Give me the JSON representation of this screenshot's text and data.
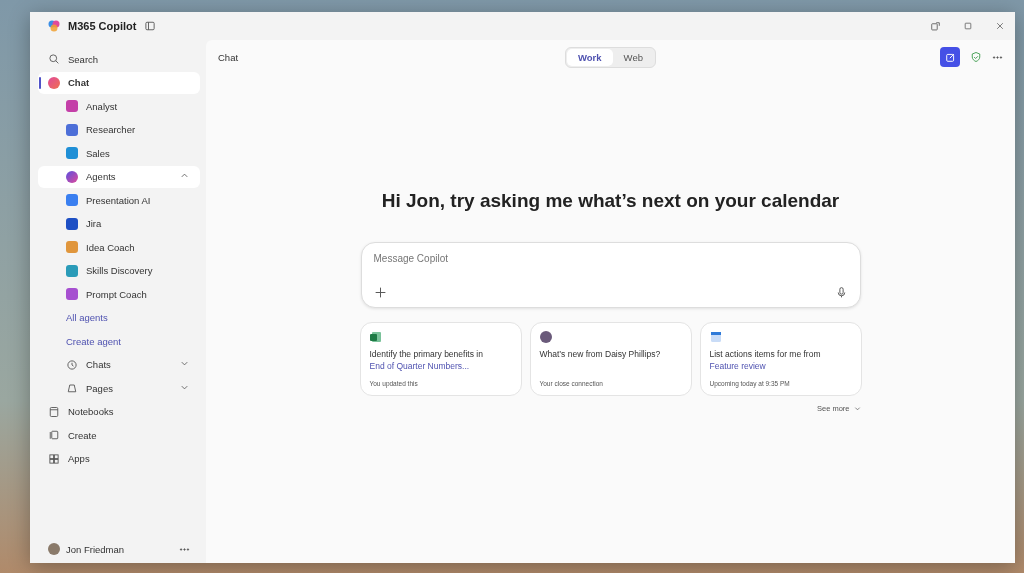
{
  "window": {
    "title": "M365 Copilot"
  },
  "sidebar": {
    "search": "Search",
    "items": [
      {
        "label": "Chat",
        "kind": "chat",
        "selected": true,
        "hovered": false,
        "children": [
          {
            "label": "Analyst",
            "kind": "agent",
            "color": "#c43fa8",
            "selected": false,
            "hovered": false
          },
          {
            "label": "Researcher",
            "kind": "agent",
            "color": "#4d6fd8",
            "selected": false,
            "hovered": false
          },
          {
            "label": "Sales",
            "kind": "agent",
            "color": "#1f8fd6",
            "selected": false,
            "hovered": false
          },
          {
            "label": "Agents",
            "kind": "agents",
            "selected": false,
            "hovered": true,
            "expanded": true,
            "children": [
              {
                "label": "Presentation AI",
                "kind": "agent",
                "color": "#3a7ff0",
                "selected": false,
                "hovered": false
              },
              {
                "label": "Jira",
                "kind": "agent",
                "color": "#1d4fc4",
                "selected": false,
                "hovered": false
              },
              {
                "label": "Idea Coach",
                "kind": "agent",
                "color": "#e0963c",
                "selected": false,
                "hovered": false
              },
              {
                "label": "Skills Discovery",
                "kind": "agent",
                "color": "#2a9bb8",
                "selected": false,
                "hovered": false
              },
              {
                "label": "Prompt Coach",
                "kind": "agent",
                "color": "#a64fd0",
                "selected": false,
                "hovered": false
              },
              {
                "label": "All agents",
                "kind": "link",
                "selected": false,
                "hovered": false
              },
              {
                "label": "Create agent",
                "kind": "link",
                "selected": false,
                "hovered": false
              }
            ]
          },
          {
            "label": "Chats",
            "kind": "history",
            "selected": false,
            "hovered": false,
            "expanded": false
          },
          {
            "label": "Pages",
            "kind": "pages",
            "selected": false,
            "hovered": false,
            "expanded": false
          }
        ]
      },
      {
        "label": "Notebooks",
        "kind": "notebooks",
        "selected": false,
        "hovered": false
      },
      {
        "label": "Create",
        "kind": "create",
        "selected": false,
        "hovered": false
      },
      {
        "label": "Apps",
        "kind": "apps",
        "selected": false,
        "hovered": false
      }
    ],
    "user": "Jon Friedman"
  },
  "header": {
    "title": "Chat",
    "tabs": [
      {
        "label": "Work",
        "selected": true
      },
      {
        "label": "Web",
        "selected": false
      }
    ]
  },
  "greeting": "Hi Jon, try asking me what’s next on your calendar",
  "composer": {
    "placeholder": "Message Copilot"
  },
  "cards": [
    {
      "kind": "spreadsheet",
      "text": "Identify the primary benefits in",
      "link": "End of Quarter Numbers...",
      "note": "You updated this"
    },
    {
      "kind": "person",
      "text": "What’s new from Daisy Phillips?",
      "note": "Your close connection"
    },
    {
      "kind": "calendar",
      "text": "List actions items for me from",
      "link": "Feature review",
      "note": "Upcoming today at 9:35 PM"
    }
  ],
  "see_more": "See more"
}
